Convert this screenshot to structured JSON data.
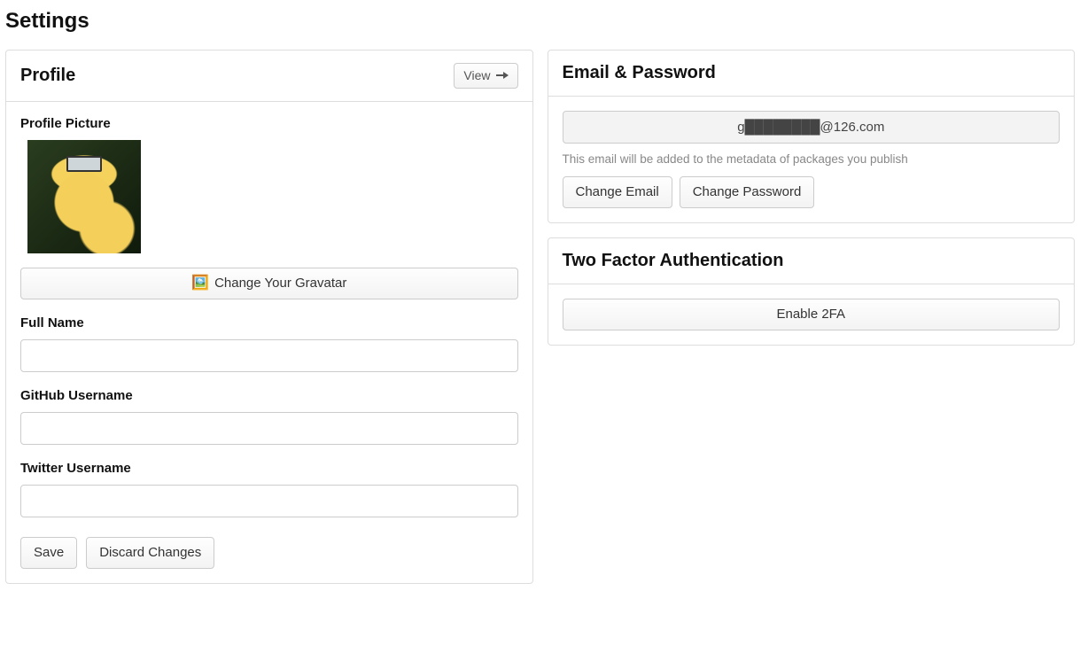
{
  "page": {
    "title": "Settings"
  },
  "profile": {
    "heading": "Profile",
    "view_label": "View",
    "picture_label": "Profile Picture",
    "change_gravatar_label": "Change Your Gravatar",
    "full_name_label": "Full Name",
    "full_name_value": "",
    "github_label": "GitHub Username",
    "github_value": "",
    "twitter_label": "Twitter Username",
    "twitter_value": "",
    "save_label": "Save",
    "discard_label": "Discard Changes"
  },
  "email": {
    "heading": "Email & Password",
    "current_email": "g████████@126.com",
    "help_text": "This email will be added to the metadata of packages you publish",
    "change_email_label": "Change Email",
    "change_password_label": "Change Password"
  },
  "tfa": {
    "heading": "Two Factor Authentication",
    "enable_label": "Enable 2FA"
  }
}
